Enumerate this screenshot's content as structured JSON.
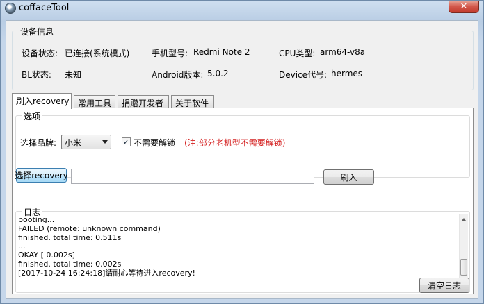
{
  "window": {
    "title": "coffaceTool",
    "close_label": "✕"
  },
  "device_info": {
    "legend": "设备信息",
    "fields": [
      {
        "label": "设备状态:",
        "value": "已连接(系统模式)"
      },
      {
        "label": "手机型号:",
        "value": "Redmi Note 2"
      },
      {
        "label": "CPU类型:",
        "value": "arm64-v8a"
      },
      {
        "label": "BL状态:",
        "value": "未知"
      },
      {
        "label": "Android版本:",
        "value": "5.0.2"
      },
      {
        "label": "Device代号:",
        "value": "hermes"
      }
    ]
  },
  "tabs": [
    {
      "label": "刷入recovery",
      "active": true
    },
    {
      "label": "常用工具",
      "active": false
    },
    {
      "label": "捐赠开发者",
      "active": false
    },
    {
      "label": "关于软件",
      "active": false
    }
  ],
  "options": {
    "legend": "选项",
    "brand_label": "选择品牌:",
    "brand_selected": "小米",
    "unlock_checked": true,
    "unlock_label": "不需要解锁",
    "unlock_note": "(注:部分老机型不需要解锁)",
    "select_recovery_label": "选择recovery",
    "recovery_path": "",
    "flash_label": "刷入"
  },
  "log": {
    "legend": "日志",
    "lines": [
      "booting...",
      "FAILED (remote: unknown command)",
      "finished. total time: 0.511s",
      "...",
      "OKAY [  0.002s]",
      "finished. total time: 0.002s",
      "[2017-10-24 16:24:18]请耐心等待进入recovery!"
    ],
    "clear_label": "清空日志"
  },
  "colors": {
    "note_red": "#d42020",
    "close_red": "#c23b2d"
  }
}
